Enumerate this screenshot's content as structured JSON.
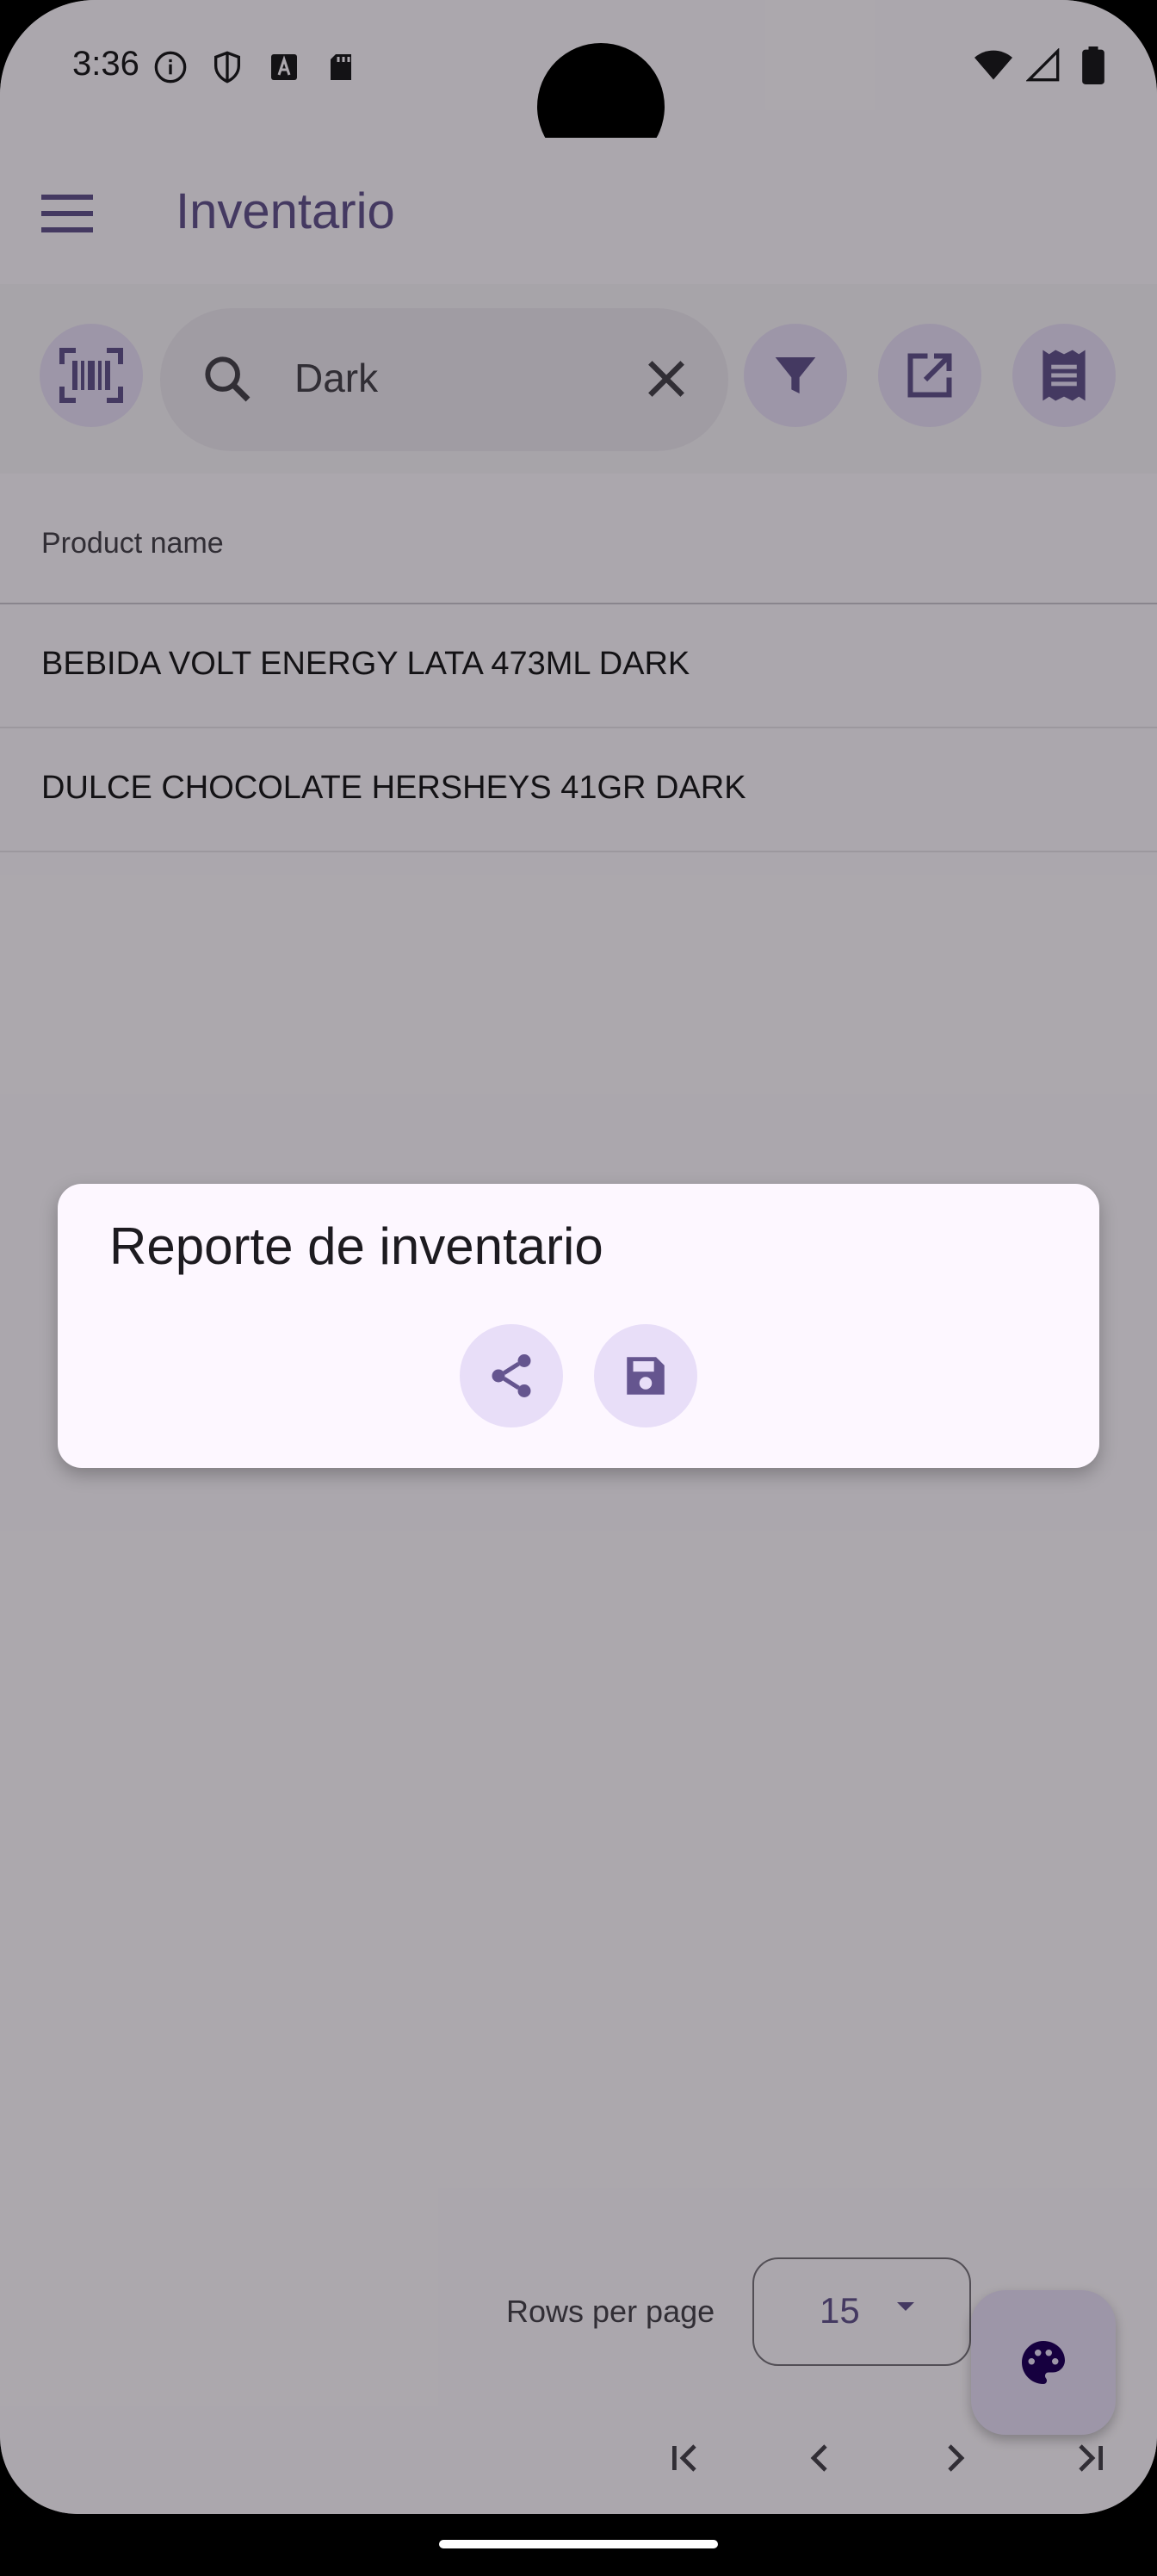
{
  "status_bar": {
    "time": "3:36",
    "left_icons": [
      "info-icon",
      "shield-icon",
      "font-a-icon",
      "sd-card-icon"
    ],
    "right_icons": [
      "wifi-icon",
      "signal-icon",
      "battery-icon"
    ]
  },
  "app_bar": {
    "title": "Inventario",
    "menu_icon": "menu-icon"
  },
  "toolbar": {
    "search_value": "Dark",
    "buttons": [
      "barcode-scan-icon",
      "filter-icon",
      "open-external-icon",
      "receipt-icon"
    ]
  },
  "table": {
    "column_header": "Product name",
    "rows": [
      "BEBIDA VOLT ENERGY LATA 473ML DARK",
      "DULCE CHOCOLATE HERSHEYS 41GR DARK"
    ]
  },
  "footer": {
    "rows_per_page_label": "Rows per page",
    "rows_per_page_value": "15"
  },
  "dialog": {
    "title": "Reporte de inventario",
    "actions": [
      "share-icon",
      "save-icon"
    ]
  },
  "colors": {
    "primary": "#65558f",
    "surface": "#fdf7ff",
    "container": "#e8def8"
  }
}
